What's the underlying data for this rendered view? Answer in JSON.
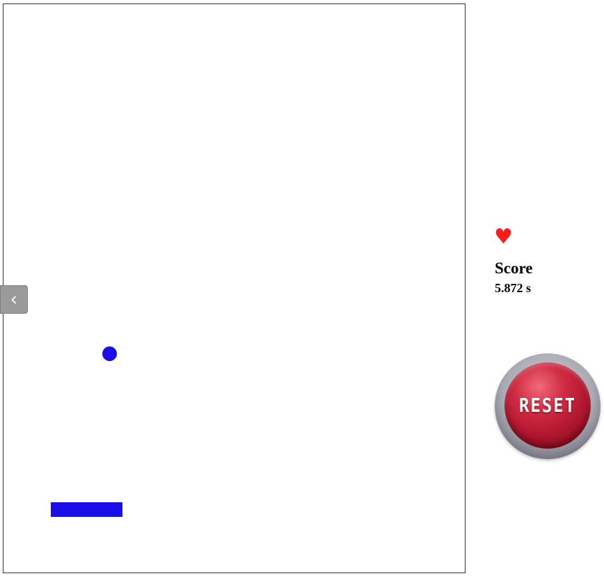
{
  "game": {
    "lives": 1,
    "score_title": "Score",
    "score_value": "5.872 s",
    "reset_label": "RESET"
  },
  "icons": {
    "heart": "heart-icon",
    "toggle": "chevron-left-icon"
  },
  "colors": {
    "ball": "#1b0ee8",
    "paddle": "#1b0ee8",
    "heart": "#ff1a1a",
    "reset_button": "#c41e36"
  }
}
